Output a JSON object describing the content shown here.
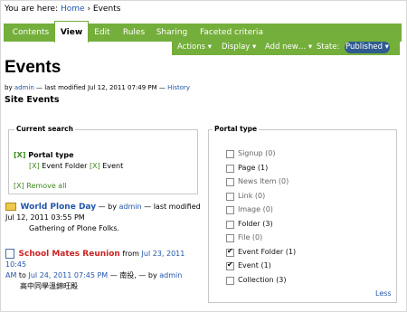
{
  "breadcrumb": {
    "prefix": "You are here:",
    "home": "Home",
    "sep": "›",
    "current": "Events"
  },
  "tabs": [
    {
      "label": "Contents"
    },
    {
      "label": "View",
      "active": true
    },
    {
      "label": "Edit"
    },
    {
      "label": "Rules"
    },
    {
      "label": "Sharing"
    },
    {
      "label": "Faceted criteria"
    }
  ],
  "actions": {
    "actions": "Actions ▾",
    "display": "Display ▾",
    "add_new": "Add new… ▾",
    "state_label": "State:",
    "state_value": "Published ▾"
  },
  "page": {
    "title": "Events",
    "by": "by",
    "author": "admin",
    "modified": "— last modified Jul 12, 2011 07:49 PM —",
    "history": "History",
    "subtitle": "Site Events"
  },
  "current_search": {
    "legend": "Current search",
    "x": "[X]",
    "portal_type": "Portal type",
    "f1": "Event Folder",
    "f2": "Event",
    "remove_all": "Remove all"
  },
  "results": [
    {
      "title": "World Plone Day",
      "meta1": "— by",
      "author": "admin",
      "meta2": "— last modified",
      "date": "Jul 12, 2011 03:55 PM",
      "desc": "Gathering of Plone Folks."
    },
    {
      "title": "School Mates Reunion",
      "from": "from",
      "start": "Jul 23, 2011 10:45",
      "start2": "AM",
      "to": "to",
      "end": "Jul 24, 2011 07:45 PM",
      "place": "— 南投, — by",
      "author": "admin",
      "desc": "高中同學溫錦旺殿"
    }
  ],
  "portal_type": {
    "legend": "Portal type",
    "items": [
      {
        "label": "Signup (0)",
        "checked": false,
        "dim": true
      },
      {
        "label": "Page (1)",
        "checked": false,
        "dim": false
      },
      {
        "label": "News Item (0)",
        "checked": false,
        "dim": true
      },
      {
        "label": "Link (0)",
        "checked": false,
        "dim": true
      },
      {
        "label": "Image (0)",
        "checked": false,
        "dim": true
      },
      {
        "label": "Folder (3)",
        "checked": false,
        "dim": false
      },
      {
        "label": "File (0)",
        "checked": false,
        "dim": true
      },
      {
        "label": "Event Folder (1)",
        "checked": true,
        "dim": false
      },
      {
        "label": "Event (1)",
        "checked": true,
        "dim": false
      },
      {
        "label": "Collection (3)",
        "checked": false,
        "dim": false
      }
    ],
    "less": "Less"
  },
  "colors": {
    "green": "#74ae3b",
    "state_pill": "#2f5b8f",
    "link": "#2255aa",
    "event_title": "#cc2222"
  }
}
